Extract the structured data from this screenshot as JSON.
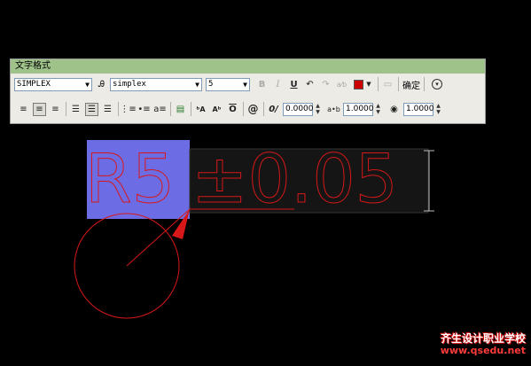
{
  "toolbar": {
    "title": "文字格式",
    "style_value": "SIMPLEX",
    "font_value": "simplex",
    "height_value": "5",
    "bold_icon": "B",
    "italic_icon": "I",
    "underline_icon": "U",
    "ok_label": "确定",
    "oblique_value": "0.0000",
    "tracking_value": "1.0000",
    "width_value": "1.0000",
    "text_color": "#cc0000",
    "title_bar_color": "#9fc28a"
  },
  "canvas": {
    "text_left": "R5",
    "text_right": "±0.05",
    "text_color": "#d81818",
    "selection_color": "#6c6ce4"
  },
  "watermark": {
    "line1": "齐生设计职业学校",
    "line2": "www.qsedu.net"
  }
}
